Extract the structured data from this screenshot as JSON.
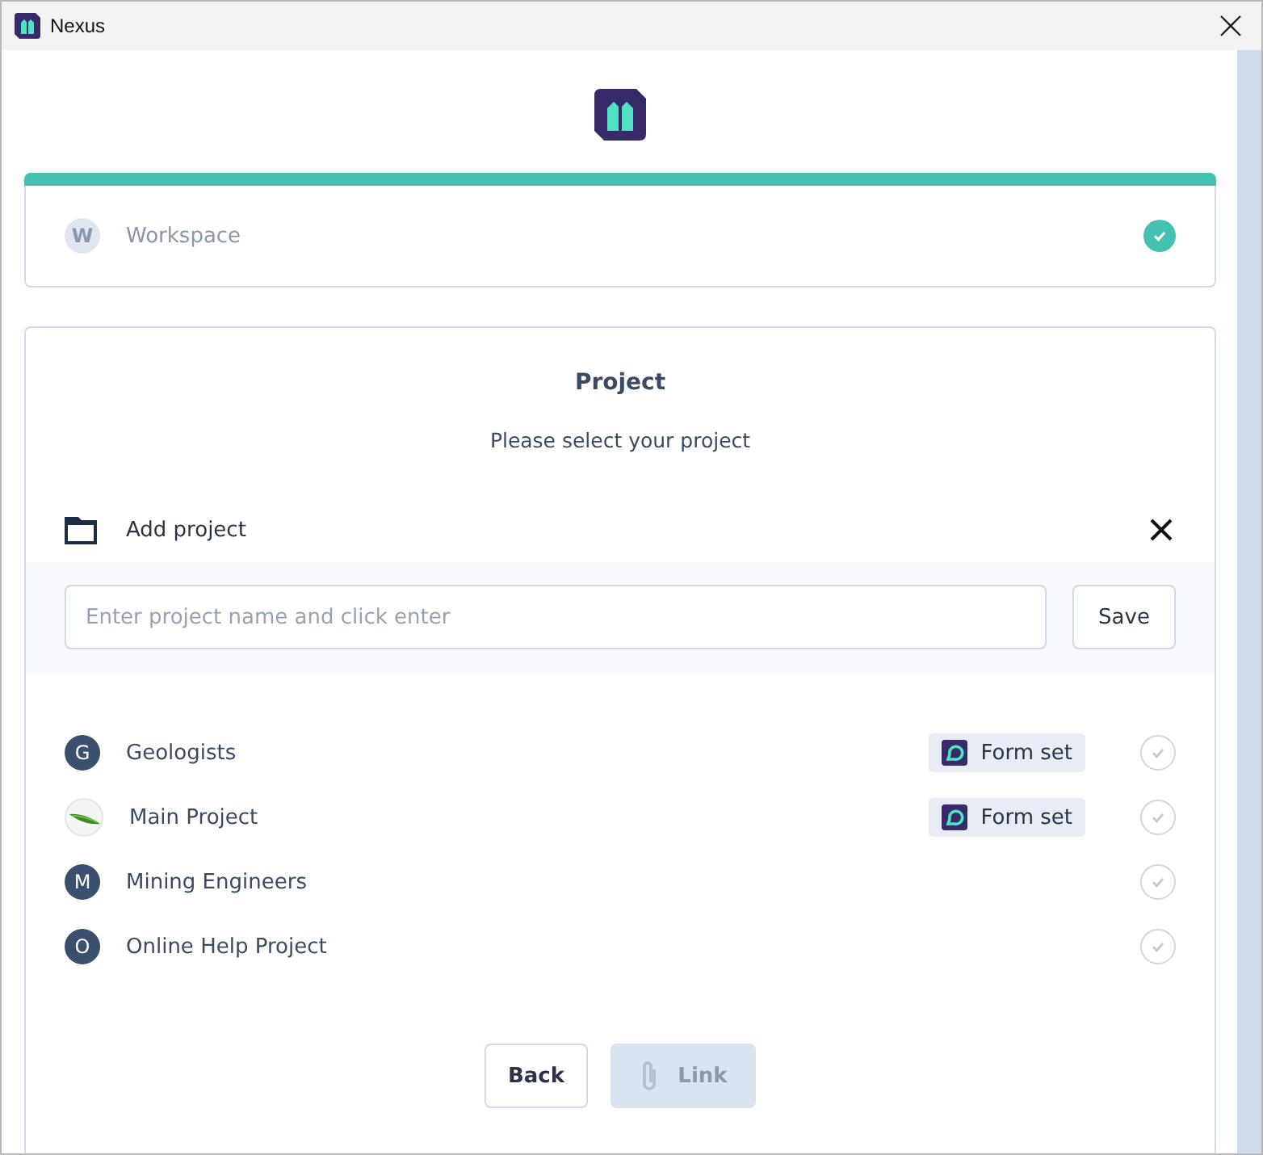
{
  "window": {
    "title": "Nexus"
  },
  "progress": {
    "level": 1
  },
  "workspace_step": {
    "letter": "W",
    "label": "Workspace",
    "completed": true
  },
  "project_step": {
    "title": "Project",
    "subtitle": "Please select your project",
    "add_project": {
      "label": "Add project",
      "expanded": true,
      "placeholder": "Enter project name and click enter",
      "save": "Save"
    },
    "projects": [
      {
        "avatar": {
          "kind": "letter",
          "letter": "G"
        },
        "name": "Geologists",
        "badge": "Form set",
        "selected": false
      },
      {
        "name": "Main Project",
        "badge": "Form set",
        "selected": false
      },
      {
        "avatar": {
          "kind": "letter",
          "letter": "M"
        },
        "name": "Mining Engineers",
        "selected": false
      },
      {
        "avatar": {
          "kind": "letter",
          "letter": "O"
        },
        "name": "Online Help Project",
        "selected": false
      }
    ],
    "buttons": {
      "back": "Back",
      "link": {
        "label": "Link",
        "disabled": true
      }
    }
  }
}
